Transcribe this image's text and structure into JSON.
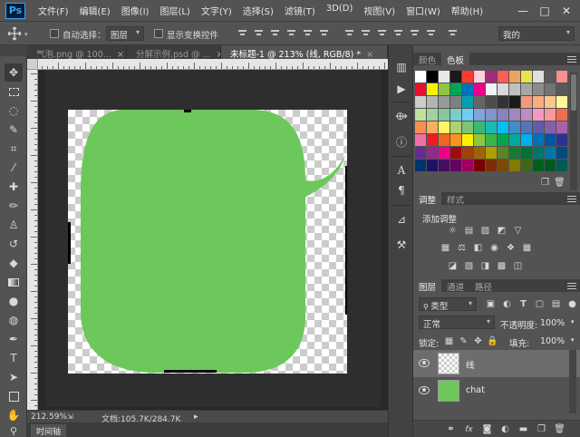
{
  "menubar": {
    "logo": "Ps",
    "items": [
      "文件(F)",
      "编辑(E)",
      "图像(I)",
      "图层(L)",
      "文字(Y)",
      "选择(S)",
      "滤镜(T)",
      "3D(D)",
      "视图(V)",
      "窗口(W)",
      "帮助(H)"
    ],
    "window_controls": [
      "—",
      "□",
      "✕"
    ]
  },
  "options": {
    "auto_select_label": "自动选择：",
    "auto_select_target": "图层",
    "show_transform_label": "显示变换控件",
    "workspace": "我的"
  },
  "tabs": [
    {
      "label": "气泡.png @ 100...",
      "close": "×"
    },
    {
      "label": "分解示例.psd @ ...",
      "close": "×"
    },
    {
      "label": "未标题-1 @ 213% (线, RGB/8) *",
      "close": "×"
    }
  ],
  "canvas": {
    "shape_color": "#6cc85a",
    "handle_color": "#000000"
  },
  "status": {
    "zoom": "212.59%",
    "doc_info": "文档:105.7K/284.7K",
    "arrow": "▸"
  },
  "timeline": {
    "label": "时间轴"
  },
  "color_panel": {
    "tabs": [
      "颜色",
      "色板"
    ],
    "active_tab": "色板",
    "swatches": [
      "#ffffff",
      "#000000",
      "#e8e8e8",
      "#1a1a1a",
      "#ff3b30",
      "#ffd1dc",
      "#9c2f7b",
      "#ff5c5c",
      "#f0a35c",
      "#e6e64c",
      "#e0e0e0",
      "#5a5a5a",
      "#ff8e8e",
      "#e8112d",
      "#fff200",
      "#8dc63f",
      "#00a651",
      "#0072bc",
      "#ec008c",
      "#f2f2f2",
      "#d9d9d9",
      "#bfbfbf",
      "#a6a6a6",
      "#8c8c8c",
      "#737373",
      "#595959",
      "#cccccc",
      "#b3b3b3",
      "#999999",
      "#808080",
      "#00a0b0",
      "#666666",
      "#4d4d4d",
      "#333333",
      "#1a1a1a",
      "#f7977a",
      "#f9ad81",
      "#fdc68a",
      "#fff79a",
      "#c4df9b",
      "#a3d39c",
      "#82ca9d",
      "#7bcdc8",
      "#6ecff6",
      "#7ea7d8",
      "#8493ca",
      "#8882be",
      "#a187be",
      "#bc8dbf",
      "#f49ac2",
      "#f6989d",
      "#f26c4f",
      "#f68e55",
      "#fbaf5c",
      "#fff467",
      "#acd372",
      "#7cc576",
      "#3bb878",
      "#1abbb4",
      "#00bff3",
      "#438cca",
      "#5574b9",
      "#605ca8",
      "#855fa8",
      "#a763a8",
      "#f06eaa",
      "#ed1c24",
      "#f26522",
      "#f7941d",
      "#fff200",
      "#8dc73f",
      "#39b54a",
      "#00a651",
      "#00a99d",
      "#00aeef",
      "#0072bc",
      "#0054a6",
      "#2e3192",
      "#662d91",
      "#92278f",
      "#ec008c",
      "#9e0b0f",
      "#a0410d",
      "#a3620a",
      "#aba000",
      "#598527",
      "#1a7b30",
      "#007236",
      "#00746b",
      "#0076a3",
      "#004a80",
      "#003471",
      "#1b1464",
      "#440e62",
      "#630460",
      "#9e005d",
      "#790000",
      "#7b2e00",
      "#7d4900",
      "#827b00",
      "#406618",
      "#005e20",
      "#005826",
      "#005952"
    ]
  },
  "adjust_panel": {
    "tabs": [
      "调整",
      "样式"
    ],
    "active_tab": "调整",
    "label": "添加调整"
  },
  "layers_panel": {
    "tabs": [
      "图层",
      "通道",
      "路径"
    ],
    "active_tab": "图层",
    "filter": "类型",
    "blend_mode": "正常",
    "opacity_label": "不透明度:",
    "opacity": "100%",
    "lock_label": "锁定:",
    "fill_label": "填充:",
    "fill": "100%",
    "layers": [
      {
        "name": "线",
        "selected": true,
        "thumb": "checker"
      },
      {
        "name": "chat",
        "selected": false,
        "thumb": "green"
      }
    ],
    "bottom_icons": [
      "link-icon",
      "fx-icon",
      "mask-icon",
      "adjustment-icon",
      "group-icon",
      "new-layer-icon",
      "trash-icon"
    ]
  }
}
